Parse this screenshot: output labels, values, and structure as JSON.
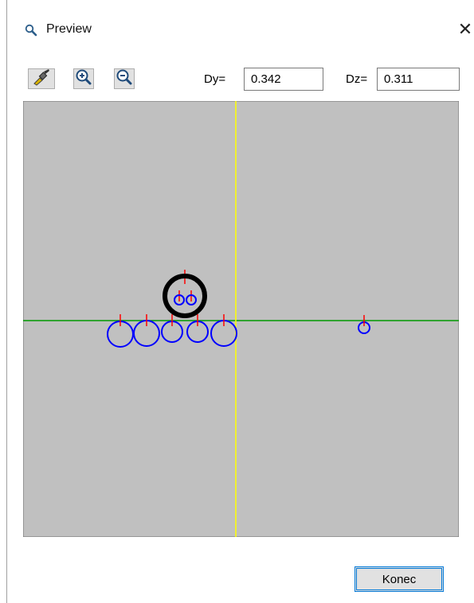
{
  "window": {
    "title": "Preview",
    "title_icon": "magnifier-icon",
    "close_glyph": "✕"
  },
  "toolbar": {
    "buttons": [
      {
        "name": "brush-button",
        "icon": "brush-icon"
      },
      {
        "name": "zoom-in-button",
        "icon": "zoom-in-icon"
      },
      {
        "name": "zoom-out-button",
        "icon": "zoom-out-icon"
      }
    ],
    "dy_label": "Dy=",
    "dy_value": "0.342",
    "dz_label": "Dz=",
    "dz_value": "0.311"
  },
  "preview": {
    "background_color": "#c0c0c0",
    "horizontal_axis_color": "#009900",
    "vertical_axis_color": "#ffff00",
    "circle_color": "#0000ff",
    "marker_color": "#ff0000",
    "highlight_color": "#000000"
  },
  "footer": {
    "close_label": "Konec"
  }
}
